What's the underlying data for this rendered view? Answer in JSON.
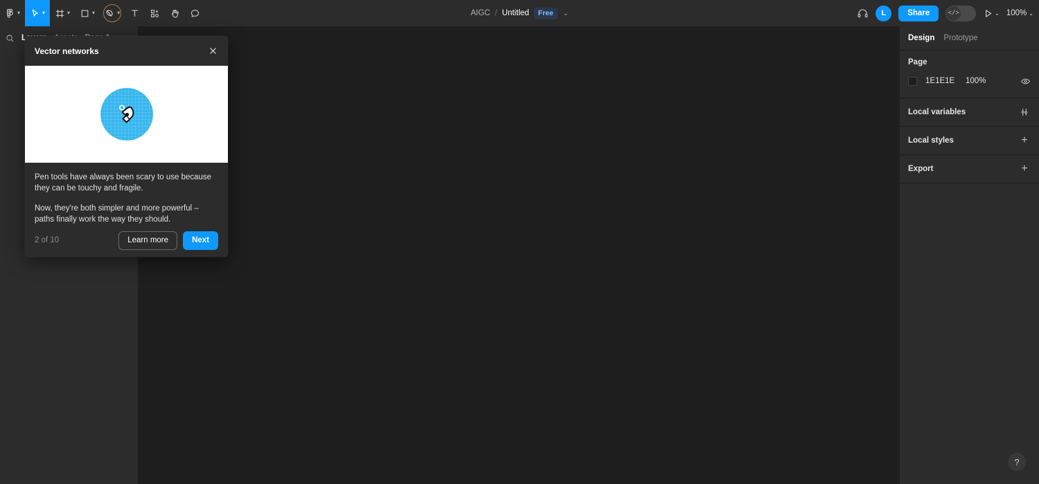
{
  "app": {
    "background_color": "#1E1E1E",
    "accent_color": "#0D99FF",
    "panel_color": "#2C2C2C"
  },
  "toolbar": {
    "tools": [
      {
        "name": "figma-menu-icon",
        "label": "Main menu",
        "caret": "⌄",
        "active": false
      },
      {
        "name": "move-tool-icon",
        "label": "Move",
        "caret": "⌄",
        "active": true
      },
      {
        "name": "frame-tool-icon",
        "label": "Frame",
        "caret": "⌄",
        "active": false
      },
      {
        "name": "shape-tool-icon",
        "label": "Rectangle",
        "caret": "⌄",
        "active": false
      },
      {
        "name": "pen-tool-icon",
        "label": "Pen",
        "caret": "⌄",
        "active": false,
        "highlighted": true
      },
      {
        "name": "text-tool-icon",
        "label": "Text",
        "caret": "",
        "active": false
      },
      {
        "name": "resources-icon",
        "label": "Actions",
        "caret": "",
        "active": false
      },
      {
        "name": "hand-tool-icon",
        "label": "Hand tool",
        "caret": "",
        "active": false
      },
      {
        "name": "comment-tool-icon",
        "label": "Comment",
        "caret": "",
        "active": false
      }
    ],
    "breadcrumb": {
      "project": "AIGC",
      "separator": "/",
      "file": "Untitled",
      "badge": "Free",
      "caret": "⌄"
    },
    "right": {
      "headphones_label": "Audio",
      "avatar_initial": "L",
      "share_label": "Share",
      "devmode_glyph": "</>",
      "play_label": "Present",
      "play_caret": "⌄",
      "zoom_level": "100%",
      "zoom_caret": "⌄"
    }
  },
  "left_panel": {
    "search_label": "Search",
    "tabs": [
      {
        "label": "Layers",
        "active": true
      },
      {
        "label": "Assets",
        "active": false
      }
    ],
    "page_name": "Page 1",
    "page_caret": "⌃"
  },
  "right_panel": {
    "tabs": [
      {
        "label": "Design",
        "active": true
      },
      {
        "label": "Prototype",
        "active": false
      }
    ],
    "page": {
      "title": "Page",
      "color_hex": "1E1E1E",
      "opacity": "100%",
      "visibility_label": "Toggle visibility"
    },
    "rows": [
      {
        "label": "Local variables",
        "action": "sliders",
        "action_label": "Open variables"
      },
      {
        "label": "Local styles",
        "action": "plus",
        "action_label": "Add style"
      },
      {
        "label": "Export",
        "action": "plus",
        "action_label": "Add export setting"
      }
    ]
  },
  "popup": {
    "title": "Vector networks",
    "close_label": "Close",
    "illustration": {
      "name": "pen-tool-illustration",
      "circle_color": "#36B6EF",
      "background": "#FFFFFF"
    },
    "paragraphs": [
      "Pen tools have always been scary to use because they can be touchy and fragile.",
      "Now, they're both simpler and more powerful – paths finally work the way they should."
    ],
    "counter": "2 of 10",
    "learn_more_label": "Learn more",
    "next_label": "Next"
  },
  "help": {
    "glyph": "?",
    "label": "Help and resources"
  }
}
